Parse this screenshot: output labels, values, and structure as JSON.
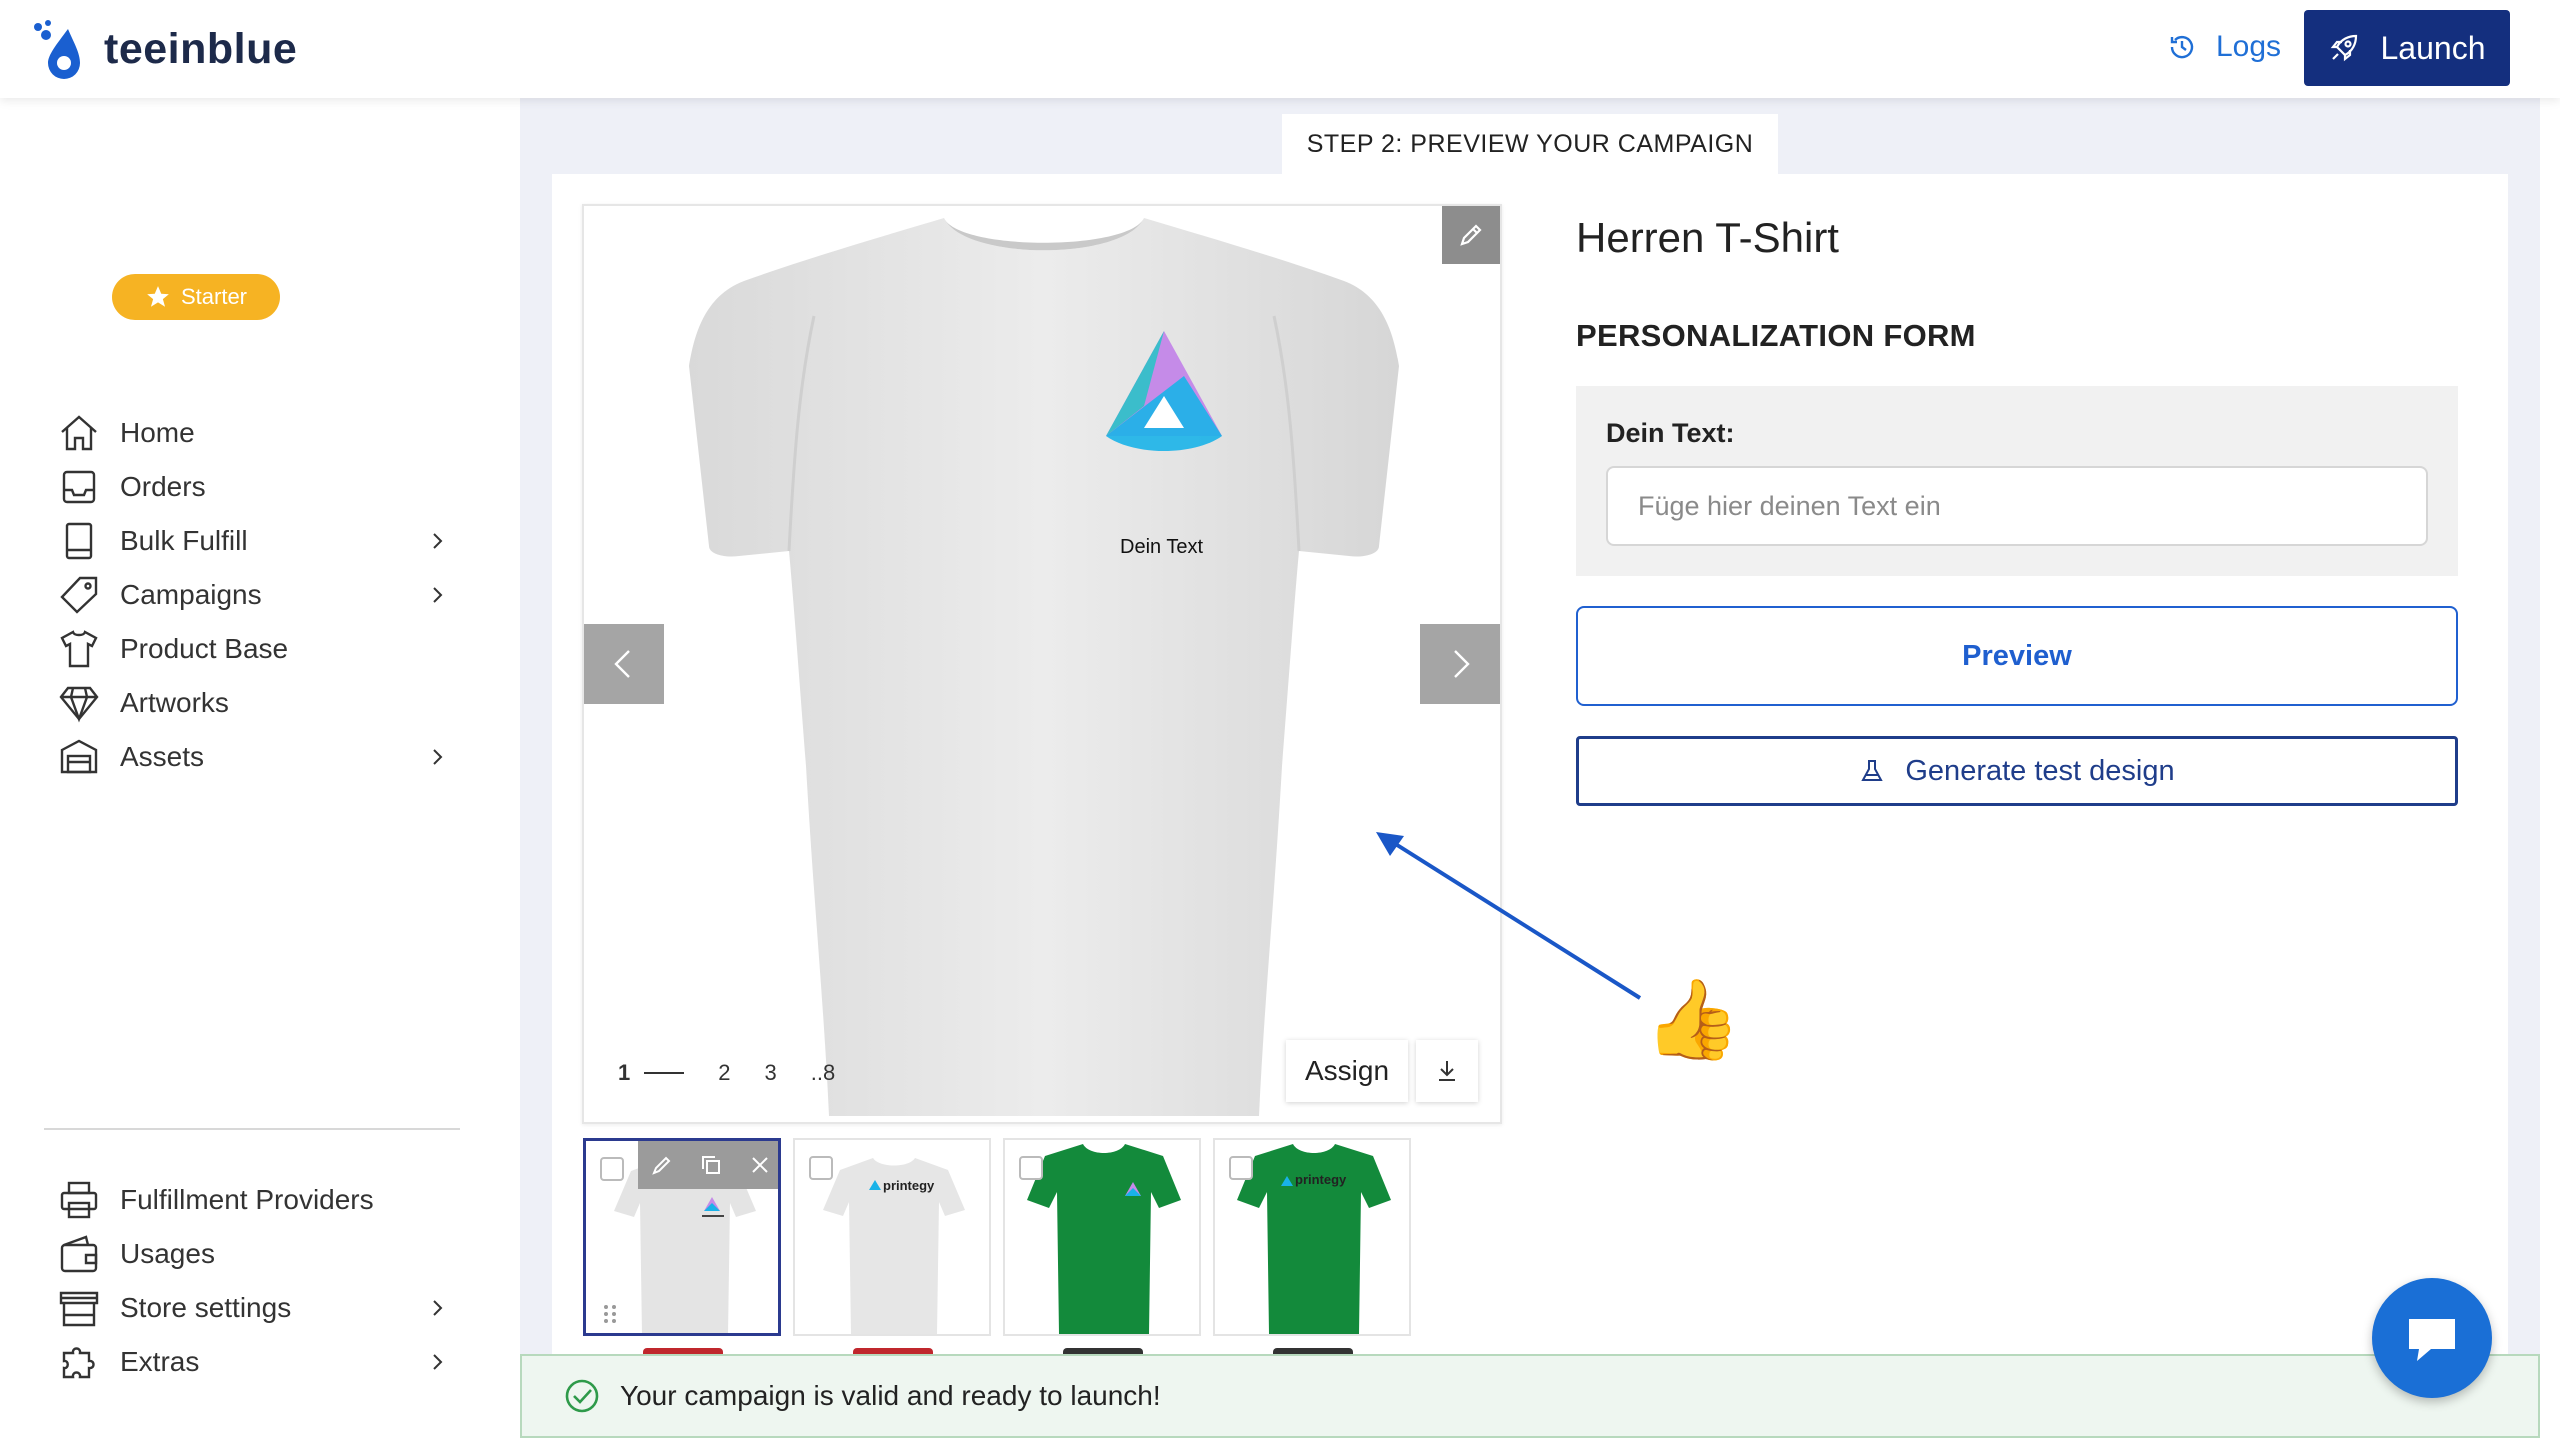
{
  "header": {
    "brand": "teeinblue",
    "logs_label": "Logs",
    "launch_label": "Launch",
    "brand_color": "#142f7e",
    "link_color": "#1f6fd6"
  },
  "sidebar": {
    "plan_badge": "Starter",
    "items": [
      {
        "label": "Home",
        "icon": "home-icon",
        "has_submenu": false
      },
      {
        "label": "Orders",
        "icon": "inbox-icon",
        "has_submenu": false
      },
      {
        "label": "Bulk Fulfill",
        "icon": "document-icon",
        "has_submenu": true
      },
      {
        "label": "Campaigns",
        "icon": "tag-icon",
        "has_submenu": true
      },
      {
        "label": "Product Base",
        "icon": "shirt-icon",
        "has_submenu": false
      },
      {
        "label": "Artworks",
        "icon": "diamond-icon",
        "has_submenu": false
      },
      {
        "label": "Assets",
        "icon": "archive-icon",
        "has_submenu": true
      },
      {
        "label": "Fulfillment Providers",
        "icon": "printer-icon",
        "has_submenu": false
      },
      {
        "label": "Usages",
        "icon": "wallet-icon",
        "has_submenu": false
      },
      {
        "label": "Store settings",
        "icon": "store-icon",
        "has_submenu": true
      },
      {
        "label": "Extras",
        "icon": "puzzle-icon",
        "has_submenu": true
      }
    ]
  },
  "main": {
    "step_title": "STEP 2: PREVIEW YOUR CAMPAIGN",
    "preview": {
      "design_text": "Dein Text",
      "pages": [
        "1",
        "2",
        "3",
        "..8"
      ],
      "active_page": "1",
      "assign_label": "Assign"
    },
    "thumbnails": [
      {
        "color": "white",
        "brand_text": "",
        "selected": true
      },
      {
        "color": "white",
        "brand_text": "printegy",
        "selected": false
      },
      {
        "color": "green",
        "brand_text": "",
        "selected": false
      },
      {
        "color": "green",
        "brand_text": "printegy",
        "selected": false
      }
    ],
    "product_title": "Herren T-Shirt",
    "form_title": "PERSONALIZATION FORM",
    "field_label": "Dein Text:",
    "field_placeholder": "Füge hier deinen Text ein",
    "field_value": "",
    "preview_button": "Preview",
    "generate_button": "Generate test design"
  },
  "status": {
    "message": "Your campaign is valid and ready to launch!"
  },
  "annotation": {
    "emoji": "👍",
    "arrow_color": "#1a57c7"
  }
}
